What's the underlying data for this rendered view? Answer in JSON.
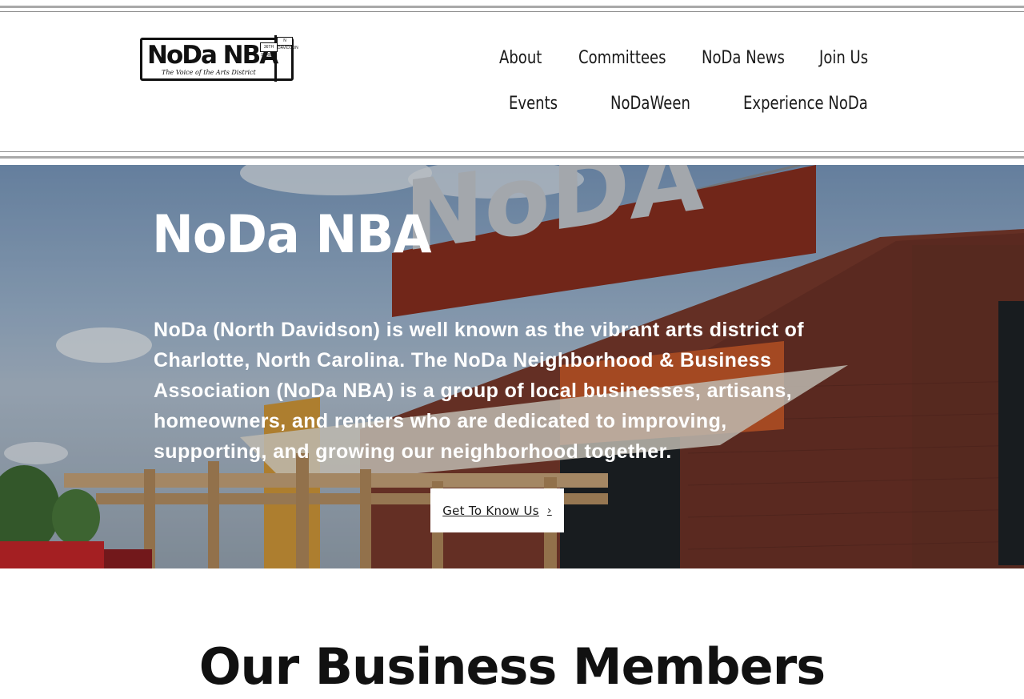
{
  "header": {
    "logo": {
      "wordmark": "NoDa NBA",
      "tagline": "The Voice of the Arts District",
      "sign_1": "36TH STREET",
      "sign_2": "N DAVIDSON"
    },
    "nav": {
      "about": "About",
      "committees": "Committees",
      "noda_news": "NoDa News",
      "join_us": "Join Us",
      "events": "Events",
      "nodaween": "NoDaWeen",
      "experience_noda": "Experience NoDa"
    }
  },
  "hero": {
    "title": "NoDa NBA",
    "body": "NoDa (North Davidson) is well known as the vibrant arts district of Charlotte, North Carolina. The NoDa Neighborhood & Business Association (NoDa NBA) is a group of local businesses, artisans, homeowners, and renters who are dedicated to improving, supporting, and growing our neighborhood together.",
    "cta_label": "Get To Know Us",
    "sign_text": "NoDA",
    "chevron_icon": "chevron-right-icon"
  },
  "section": {
    "title": "Our Business Members"
  },
  "colors": {
    "hero_text": "#ffffff",
    "nav_text": "#1a1a1a",
    "rule_gray": "#a9a9a9"
  }
}
